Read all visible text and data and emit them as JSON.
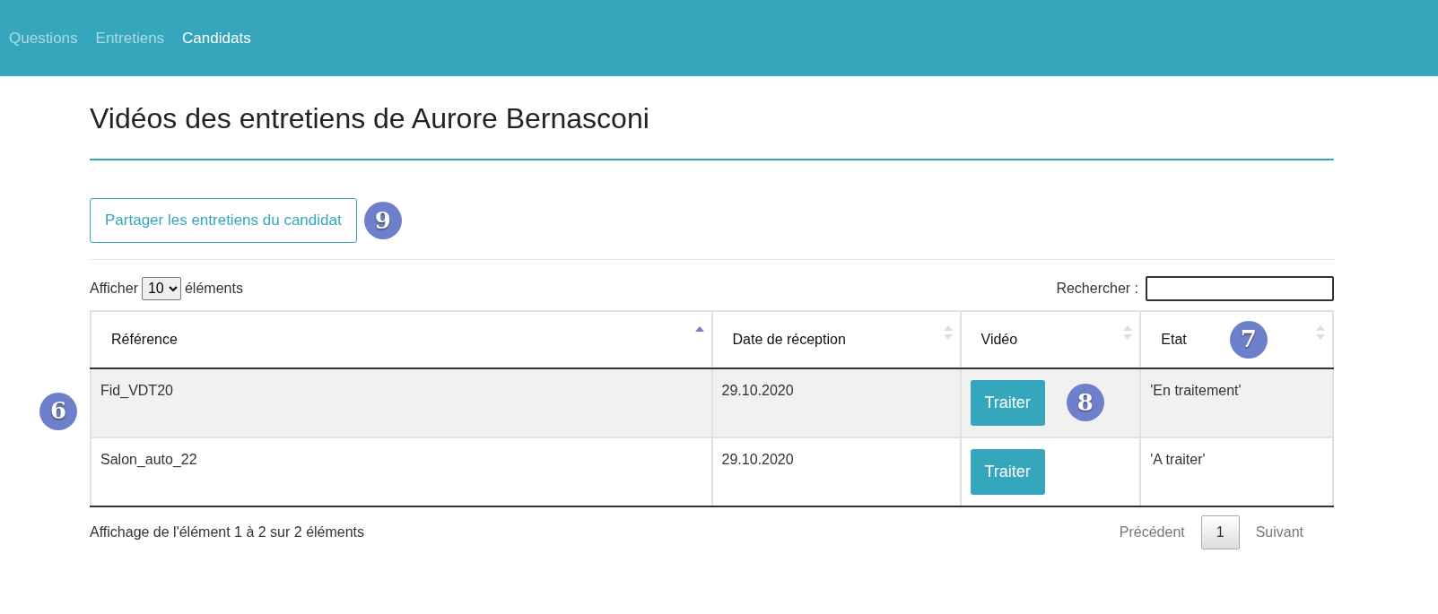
{
  "nav": {
    "items": [
      {
        "label": "Questions",
        "selected": false
      },
      {
        "label": "Entretiens",
        "selected": false
      },
      {
        "label": "Candidats",
        "selected": true
      }
    ]
  },
  "title": "Vidéos des entretiens de Aurore Bernasconi",
  "share_button": {
    "label": "Partager les entretiens du candidat",
    "marker": "9"
  },
  "length_control": {
    "prefix": "Afficher",
    "value": "10",
    "suffix": "éléments"
  },
  "search": {
    "label": "Rechercher :"
  },
  "table": {
    "marker": "6",
    "columns": [
      {
        "label": "Référence",
        "sorted": true
      },
      {
        "label": "Date de réception",
        "sorted": false
      },
      {
        "label": "Vidéo",
        "sorted": false
      },
      {
        "label": "Etat",
        "sorted": false,
        "marker": "7"
      }
    ],
    "rows": [
      {
        "reference": "Fid_VDT20",
        "date": "29.10.2020",
        "button": "Traiter",
        "status": "'En traitement'",
        "marker": "8"
      },
      {
        "reference": "Salon_auto_22",
        "date": "29.10.2020",
        "button": "Traiter",
        "status": "'A traiter'"
      }
    ]
  },
  "info": "Affichage de l'élément 1 à 2 sur 2 éléments",
  "pagination": {
    "previous": "Précédent",
    "pages": [
      {
        "label": "1",
        "selected": true
      }
    ],
    "next": "Suivant"
  }
}
